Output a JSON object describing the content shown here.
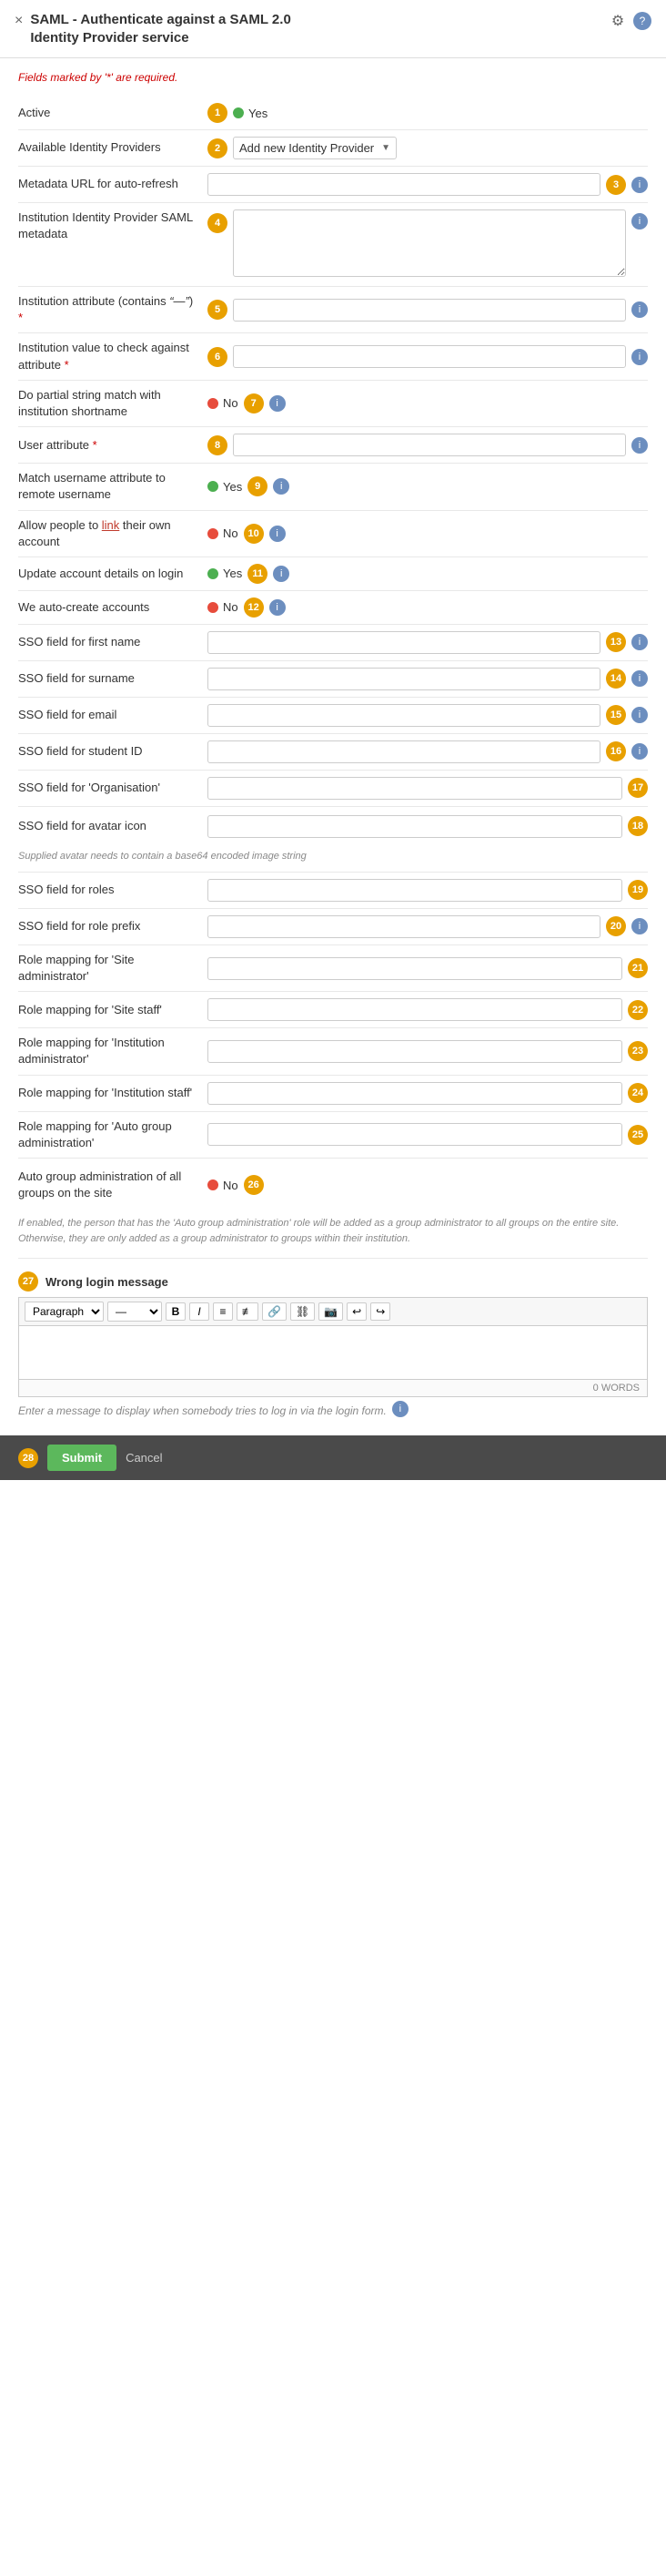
{
  "header": {
    "title": "SAML - Authenticate against a SAML 2.0 Identity Provider service",
    "close_label": "×",
    "gear_icon": "⚙",
    "help_icon": "?"
  },
  "form": {
    "required_note": "Fields marked by '*' are required.",
    "fields": [
      {
        "id": 1,
        "label": "Active",
        "type": "toggle",
        "value": "Yes",
        "dot_color": "green"
      },
      {
        "id": 2,
        "label": "Available Identity Providers",
        "type": "select",
        "value": "Add new Identity Provider",
        "has_info": false
      },
      {
        "id": 3,
        "label": "Metadata URL for auto-refresh",
        "type": "text",
        "value": "",
        "placeholder": "",
        "has_info": true
      },
      {
        "id": 4,
        "label": "Institution Identity Provider SAML metadata",
        "type": "textarea",
        "value": "",
        "has_info": true
      },
      {
        "id": 5,
        "label": "Institution attribute (contains \"—\") *",
        "label_plain": "Institution attribute (contains",
        "label_quoted": "\"—\"",
        "type": "text",
        "value": "",
        "has_info": true,
        "required": true
      },
      {
        "id": 6,
        "label": "Institution value to check against attribute *",
        "type": "text",
        "value": "",
        "has_info": true,
        "required": true
      },
      {
        "id": 7,
        "label": "Do partial string match with institution shortname",
        "type": "toggle",
        "value": "No",
        "dot_color": "red",
        "has_info": true
      },
      {
        "id": 8,
        "label": "User attribute *",
        "type": "text",
        "value": "",
        "has_info": true,
        "required": true
      },
      {
        "id": 9,
        "label": "Match username attribute to remote username",
        "type": "toggle",
        "value": "Yes",
        "dot_color": "green",
        "has_info": true
      },
      {
        "id": 10,
        "label": "Allow people to link their own account",
        "type": "toggle",
        "value": "No",
        "dot_color": "red",
        "has_info": true,
        "has_link": true,
        "link_word": "link"
      },
      {
        "id": 11,
        "label": "Update account details on login",
        "type": "toggle",
        "value": "Yes",
        "dot_color": "green",
        "has_info": true
      },
      {
        "id": 12,
        "label": "We auto-create accounts",
        "type": "toggle",
        "value": "No",
        "dot_color": "red",
        "has_info": true
      },
      {
        "id": 13,
        "label": "SSO field for first name",
        "type": "text",
        "value": "",
        "has_info": true
      },
      {
        "id": 14,
        "label": "SSO field for surname",
        "type": "text",
        "value": "",
        "has_info": true
      },
      {
        "id": 15,
        "label": "SSO field for email",
        "type": "text",
        "value": "",
        "has_info": true
      },
      {
        "id": 16,
        "label": "SSO field for student ID",
        "type": "text",
        "value": "",
        "has_info": true
      },
      {
        "id": 17,
        "label": "SSO field for 'Organisation'",
        "type": "text",
        "value": "",
        "has_info": false
      },
      {
        "id": 18,
        "label": "SSO field for avatar icon",
        "type": "text",
        "value": "",
        "has_info": false,
        "note": "Supplied avatar needs to contain a base64 encoded image string"
      },
      {
        "id": 19,
        "label": "SSO field for roles",
        "type": "text",
        "value": "",
        "has_info": false
      },
      {
        "id": 20,
        "label": "SSO field for role prefix",
        "type": "text",
        "value": "",
        "has_info": true
      },
      {
        "id": 21,
        "label": "Role mapping for 'Site administrator'",
        "type": "text",
        "value": "",
        "has_info": false
      },
      {
        "id": 22,
        "label": "Role mapping for 'Site staff'",
        "type": "text",
        "value": "",
        "has_info": false
      },
      {
        "id": 23,
        "label": "Role mapping for 'Institution administrator'",
        "type": "text",
        "value": "",
        "has_info": false
      },
      {
        "id": 24,
        "label": "Role mapping for 'Institution staff'",
        "type": "text",
        "value": "",
        "has_info": false
      },
      {
        "id": 25,
        "label": "Role mapping for 'Auto group administration'",
        "type": "text",
        "value": "",
        "has_info": false
      },
      {
        "id": 26,
        "label": "Auto group administration of all groups on the site",
        "type": "toggle",
        "value": "No",
        "dot_color": "red",
        "has_info": false,
        "note": "If enabled, the person that has the 'Auto group administration' role will be added as a group administrator to all groups on the entire site. Otherwise, they are only added as a group administrator to groups within their institution."
      },
      {
        "id": 27,
        "label": "Wrong login message",
        "type": "rte",
        "has_info": true,
        "word_count": "0 WORDS",
        "help_text": "Enter a message to display when somebody tries to log in via the login form."
      }
    ],
    "rte": {
      "toolbar": {
        "paragraph_select": "Paragraph",
        "btn_b": "B",
        "btn_i": "I",
        "btn_ul": "≡",
        "btn_ol": "≣",
        "btn_link": "🔗",
        "btn_unlink": "⛓",
        "btn_image": "🖼",
        "btn_undo": "↩",
        "btn_redo": "↪"
      }
    },
    "submit": {
      "submit_label": "Submit",
      "cancel_label": "Cancel"
    }
  }
}
